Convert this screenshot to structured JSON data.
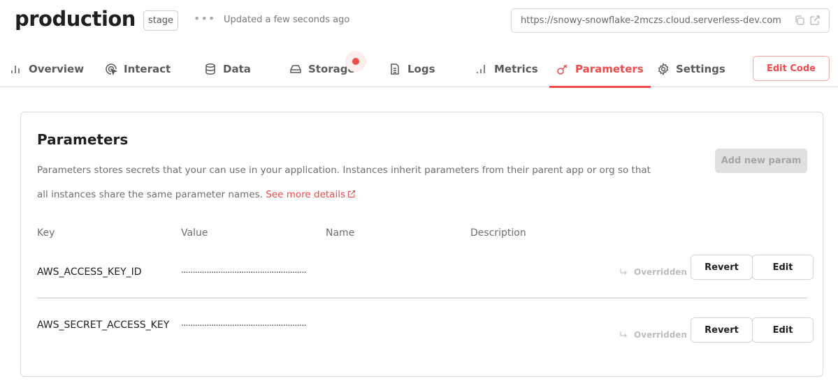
{
  "header": {
    "title": "production",
    "stage_badge": "stage",
    "more_menu": "•••",
    "updated_text": "Updated a few seconds ago",
    "url": "https://snowy-snowflake-2mczs.cloud.serverless-dev.com",
    "url_icons": [
      "copy-icon",
      "external-link-icon"
    ]
  },
  "tabs": [
    {
      "label": "Overview",
      "icon": "bar-chart-icon",
      "active": false
    },
    {
      "label": "Interact",
      "icon": "cursor-click-icon",
      "active": false
    },
    {
      "label": "Data",
      "icon": "database-icon",
      "active": false
    },
    {
      "label": "Storage",
      "icon": "drive-icon",
      "active": false,
      "notification": true
    },
    {
      "label": "Logs",
      "icon": "document-icon",
      "active": false
    },
    {
      "label": "Metrics",
      "icon": "bar-chart-icon",
      "active": false
    },
    {
      "label": "Parameters",
      "icon": "key-icon",
      "active": true
    },
    {
      "label": "Settings",
      "icon": "gear-icon",
      "active": false
    }
  ],
  "edit_code_label": "Edit Code",
  "colors": {
    "accent": "#f04a4a",
    "muted_text": "#6e6e6e",
    "border": "#d9d9d9"
  },
  "card": {
    "title": "Parameters",
    "description": "Parameters stores secrets that your can use in your application. Instances inherit parameters from their parent app or org so that all instances share the same parameter names.",
    "link_label": "See more details",
    "add_button_label": "Add new param",
    "columns": [
      "Key",
      "Value",
      "Name",
      "Description"
    ],
    "rows": [
      {
        "key": "AWS_ACCESS_KEY_ID",
        "value": "......................................................",
        "name": "",
        "description": "",
        "status": "Overridden",
        "revert_label": "Revert",
        "edit_label": "Edit"
      },
      {
        "key": "AWS_SECRET_ACCESS_KEY",
        "value": "......................................................",
        "name": "",
        "description": "",
        "status": "Overridden",
        "revert_label": "Revert",
        "edit_label": "Edit"
      }
    ]
  }
}
